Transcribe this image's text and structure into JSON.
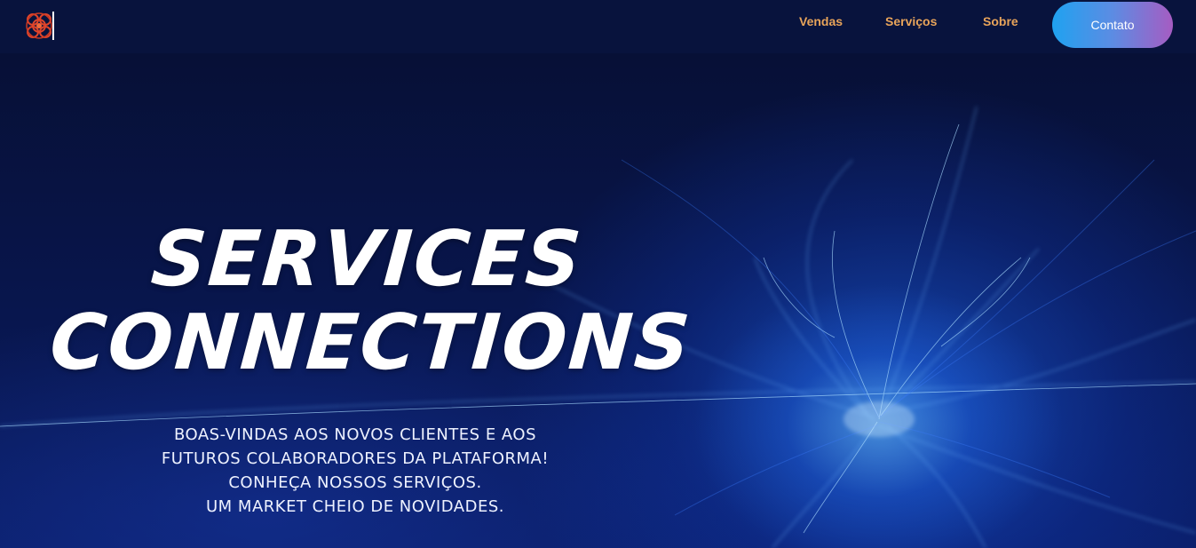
{
  "nav": {
    "links": [
      "Vendas",
      "Serviços",
      "Sobre"
    ],
    "contact_label": "Contato"
  },
  "hero": {
    "title_lines": [
      "SERVICES",
      "CONNECTIONS"
    ],
    "subtitle_lines": [
      "BOAS-VINDAS AOS NOVOS CLIENTES E AOS",
      "FUTUROS COLABORADORES DA PLATAFORMA!",
      "CONHEÇA NOSSOS SERVIÇOS.",
      "UM MARKET CHEIO DE NOVIDADES."
    ]
  },
  "colors": {
    "navbar_bg": "#08133d",
    "nav_link": "#e8a45a",
    "button_gradient_start": "#1fa2f0",
    "button_gradient_end": "#a65cc2",
    "logo": "#e0442a"
  },
  "icons": {
    "logo": "knot-logo-icon"
  }
}
